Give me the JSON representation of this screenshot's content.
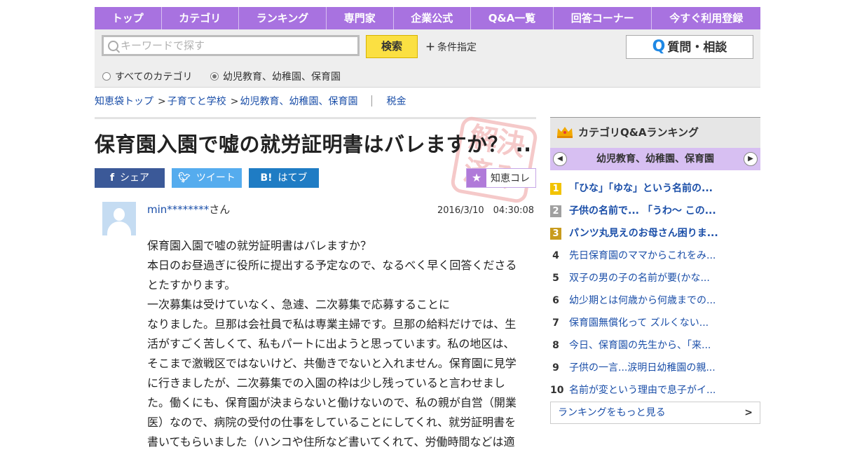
{
  "nav": [
    "トップ",
    "カテゴリ",
    "ランキング",
    "専門家",
    "企業公式",
    "Q&A一覧",
    "回答コーナー",
    "今すぐ利用登録"
  ],
  "search": {
    "placeholder": "キーワードで探す",
    "button": "検索",
    "conditions": "条件指定",
    "ask_button": "質問・相談",
    "ask_icon": "Q",
    "radio_all": "すべてのカテゴリ",
    "radio_category": "幼児教育、幼稚園、保育園",
    "selected": "radio_category"
  },
  "breadcrumb": {
    "home": "知恵袋トップ",
    "sep": ">",
    "level1": "子育てと学校",
    "level2": "幼児教育、幼稚園、保育園",
    "tag": "税金"
  },
  "question": {
    "title": "保育園入園で嘘の就労証明書はバレますか？ ...",
    "stamp_text": "解決済み",
    "share": {
      "facebook": "シェア",
      "twitter": "ツイート",
      "hatena": "はてブ",
      "facebook_icon": "f",
      "hatena_icon": "B!"
    },
    "chiekore": "知恵コレ",
    "user": "min********",
    "user_suffix": "さん",
    "date": "2016/3/10　04:30:08",
    "body": [
      "保育園入園で嘘の就労証明書はバレますか？",
      "本日のお昼過ぎに役所に提出する予定なので、なるべく早く回答くださるとたすかります。",
      "一次募集は受けていなく、急遽、二次募集で応募することに",
      "なりました。旦那は会社員で私は専業主婦です。旦那の給料だけでは、生活がすごく苦しくて、私もパートに出ようと思っています。私の地区は、そこまで激戦区ではないけど、共働きでないと入れません。保育園に見学に行きましたが、二次募集での入園の枠は少し残っていると言わせました。働くにも、保育園が決まらないと働けないので、私の親が自営（開業医）なので、病院の受付の仕事をしていることにしてくれ、就労証明書を書いてもらいました（ハンコや住所など書いてくれて、労働時間などは適"
    ]
  },
  "ranking": {
    "title": "カテゴリQ&Aランキング",
    "category": "幼児教育、幼稚園、保育園",
    "items": [
      {
        "rank": "1",
        "text": "「ひな」「ゆな」という名前の..."
      },
      {
        "rank": "2",
        "text": "子供の名前で... 「うわ～ この..."
      },
      {
        "rank": "3",
        "text": "パンツ丸見えのお母さん困りま..."
      },
      {
        "rank": "4",
        "text": "先日保育園のママからこれをみ..."
      },
      {
        "rank": "5",
        "text": "双子の男の子の名前が要(かな..."
      },
      {
        "rank": "6",
        "text": "幼少期とは何歳から何歳までの..."
      },
      {
        "rank": "7",
        "text": "保育園無償化って ズルくない..."
      },
      {
        "rank": "8",
        "text": "今日、保育園の先生から、「来..."
      },
      {
        "rank": "9",
        "text": "子供の一言...涙明日幼稚園の親..."
      },
      {
        "rank": "10",
        "text": "名前が変という理由で息子がイ..."
      }
    ],
    "more": "ランキングをもっと見る",
    "medal_colors": [
      "#f2c300",
      "#a0a0a0",
      "#c89b1e"
    ]
  }
}
